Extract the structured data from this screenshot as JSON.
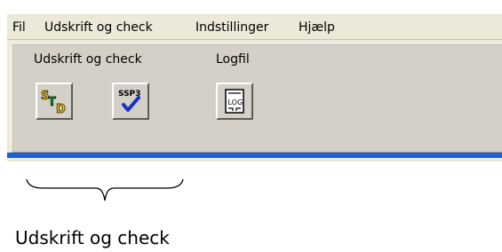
{
  "menubar": {
    "items": [
      "Fil",
      "Udskrift og check",
      "Indstillinger",
      "Hjælp"
    ]
  },
  "toolbar": {
    "groups": [
      {
        "label": "Udskrift og check",
        "buttons": [
          {
            "icon": "std-icon",
            "text": "STD"
          },
          {
            "icon": "ssp3-check-icon",
            "text": "SSP3"
          }
        ]
      },
      {
        "label": "Logfil",
        "buttons": [
          {
            "icon": "log-file-icon",
            "text": "LOG"
          }
        ]
      }
    ]
  },
  "annotation": {
    "caption": "Udskrift og check"
  },
  "colors": {
    "window_bg": "#ece9d8",
    "toolbar_bg": "#d4d0c8",
    "accent_blue": "#1f5fd4",
    "std_yellow": "#ffd400",
    "std_green": "#1aa63a",
    "check_blue": "#1633c8"
  }
}
